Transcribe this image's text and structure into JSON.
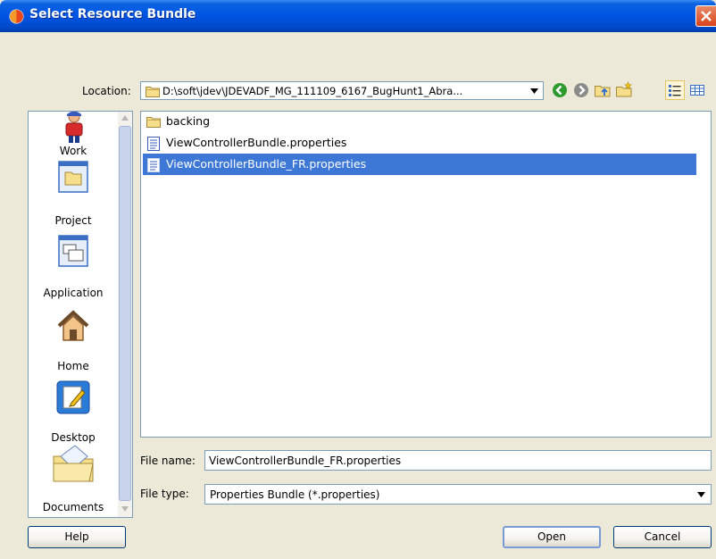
{
  "window": {
    "title": "Select Resource Bundle",
    "accent": "#0054e3"
  },
  "location": {
    "label": "Location:",
    "value": "D:\\soft\\jdev\\JDEVADF_MG_111109_6167_BugHunt1_Abra..."
  },
  "toolbar": {
    "icons": [
      "back-icon",
      "forward-icon",
      "up-folder-icon",
      "new-folder-icon",
      "list-view-icon",
      "details-view-icon"
    ]
  },
  "places": [
    {
      "label": "Work"
    },
    {
      "label": "Project"
    },
    {
      "label": "Application"
    },
    {
      "label": "Home"
    },
    {
      "label": "Desktop"
    },
    {
      "label": "Documents"
    }
  ],
  "files": [
    {
      "name": "backing",
      "type": "folder"
    },
    {
      "name": "ViewControllerBundle.properties",
      "type": "file"
    },
    {
      "name": "ViewControllerBundle_FR.properties",
      "type": "file",
      "selected": true
    }
  ],
  "file_name": {
    "label": "File name:",
    "value": "ViewControllerBundle_FR.properties"
  },
  "file_type": {
    "label": "File type:",
    "value": "Properties Bundle (*.properties)"
  },
  "buttons": {
    "help": "Help",
    "open": "Open",
    "cancel": "Cancel"
  }
}
